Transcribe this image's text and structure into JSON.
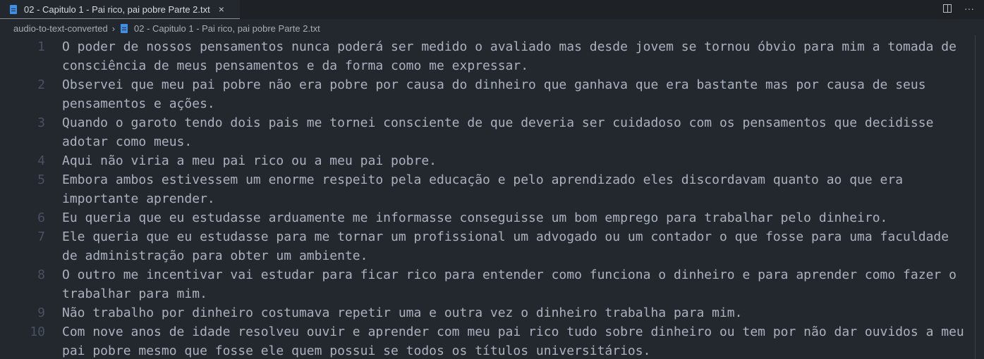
{
  "tab": {
    "title": "02 - Capitulo 1 - Pai rico, pai pobre Parte 2.txt",
    "close": "×"
  },
  "actions": {
    "more": "···"
  },
  "breadcrumb": {
    "folder": "audio-to-text-converted",
    "separator": "›",
    "file": "02 - Capitulo 1 - Pai rico, pai pobre Parte 2.txt"
  },
  "lines": [
    {
      "n": "1",
      "rows": [
        "O poder de nossos pensamentos nunca poderá ser medido o avaliado mas desde jovem se tornou óbvio para mim a tomada de",
        "consciência de meus pensamentos e da forma como me expressar."
      ]
    },
    {
      "n": "2",
      "rows": [
        "Observei que meu pai pobre não era pobre por causa do dinheiro que ganhava que era bastante mas por causa de seus",
        "pensamentos e ações."
      ]
    },
    {
      "n": "3",
      "rows": [
        "Quando o garoto tendo dois pais me tornei consciente de que deveria ser cuidadoso com os pensamentos que decidisse",
        "adotar como meus."
      ]
    },
    {
      "n": "4",
      "rows": [
        "Aqui não viria a meu pai rico ou a meu pai pobre."
      ]
    },
    {
      "n": "5",
      "rows": [
        "Embora ambos estivessem um enorme respeito pela educação e pelo aprendizado eles discordavam quanto ao que era",
        "importante aprender."
      ]
    },
    {
      "n": "6",
      "rows": [
        "Eu queria que eu estudasse arduamente me informasse conseguisse um bom emprego para trabalhar pelo dinheiro."
      ]
    },
    {
      "n": "7",
      "rows": [
        "Ele queria que eu estudasse para me tornar um profissional um advogado ou um contador o que fosse para uma faculdade",
        "de administração para obter um ambiente."
      ]
    },
    {
      "n": "8",
      "rows": [
        "O outro me incentivar vai estudar para ficar rico para entender como funciona o dinheiro e para aprender como fazer o",
        "trabalhar para mim."
      ]
    },
    {
      "n": "9",
      "rows": [
        "Não trabalho por dinheiro costumava repetir uma e outra vez o dinheiro trabalha para mim."
      ]
    },
    {
      "n": "10",
      "rows": [
        "Com nove anos de idade resolveu ouvir e aprender com meu pai rico tudo sobre dinheiro ou tem por não dar ouvidos a meu",
        "pai pobre mesmo que fosse ele quem possui se todos os títulos universitários."
      ]
    }
  ]
}
